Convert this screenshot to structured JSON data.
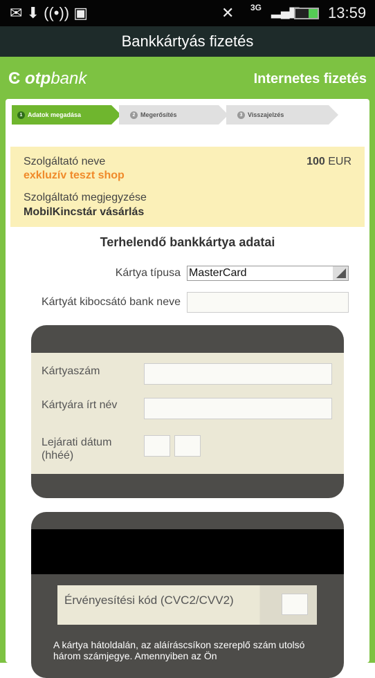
{
  "status": {
    "time": "13:59",
    "network": "3G"
  },
  "header": {
    "title": "Bankkártyás fizetés",
    "logo_bold": "otp",
    "logo_rest": "bank",
    "section": "Internetes fizetés"
  },
  "steps": [
    {
      "n": "1",
      "label": "Adatok megadása",
      "active": true
    },
    {
      "n": "2",
      "label": "Megerősítés",
      "active": false
    },
    {
      "n": "3",
      "label": "Visszajelzés",
      "active": false
    }
  ],
  "merchant": {
    "name_label": "Szolgáltató neve",
    "name": "exkluzív teszt shop",
    "amount": "100",
    "currency": "EUR",
    "note_label": "Szolgáltató megjegyzése",
    "note": "MobilKincstár vásárlás"
  },
  "form": {
    "heading": "Terhelendő bankkártya adatai",
    "card_type_label": "Kártya típusa",
    "card_type_value": "MasterCard",
    "bank_label": "Kártyát kibocsátó bank neve",
    "bank_value": ""
  },
  "card_front": {
    "number_label": "Kártyaszám",
    "name_label": "Kártyára írt név",
    "expiry_label_1": "Lejárati dátum",
    "expiry_label_2": "(hhéé)"
  },
  "card_back": {
    "cvc_label": "Érvényesítési kód (CVC2/CVV2)",
    "help_text": "A kártya hátoldalán, az aláíráscsíkon szereplő szám utolsó három számjegye. Amennyiben az Ön"
  },
  "colors": {
    "brand_green": "#7dc242",
    "accent_orange": "#f08a2a"
  }
}
